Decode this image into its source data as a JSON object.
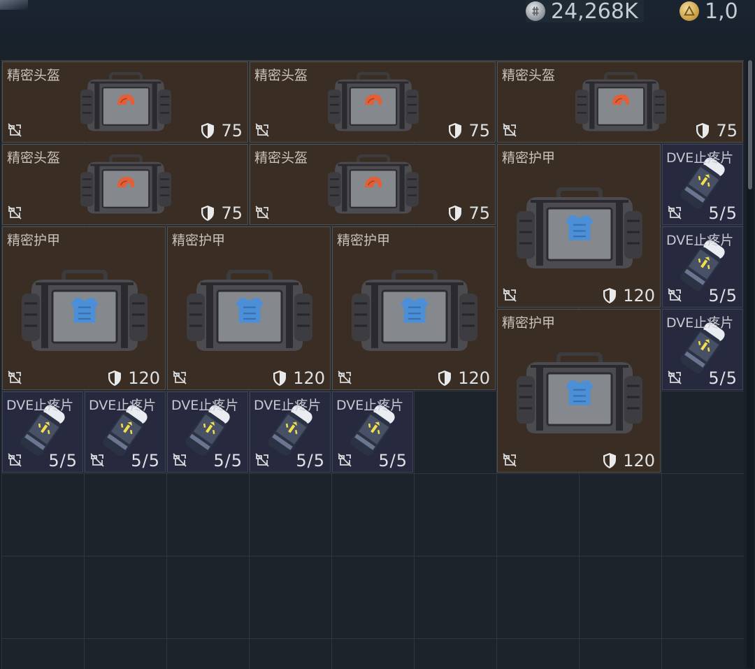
{
  "currency": {
    "primary": "24,268K",
    "secondary": "1,0"
  },
  "colors": {
    "gear_bg": "#3a2e24",
    "med_bg": "#272a3f",
    "helmet_emblem": "#e1603a",
    "armor_emblem": "#4d8fd6"
  },
  "items": {
    "helmet": {
      "name": "精密头盔",
      "durability": "75",
      "icon": "helmet-bag-icon"
    },
    "armor": {
      "name": "精密护甲",
      "durability": "120",
      "icon": "armor-bag-icon"
    },
    "painkiller": {
      "name": "DVE止疼片",
      "uses": "5/5",
      "icon": "pill-bottle-icon"
    }
  },
  "badges": {
    "no_sell_icon": "no-trade-icon",
    "durability_icon": "shield-icon"
  }
}
